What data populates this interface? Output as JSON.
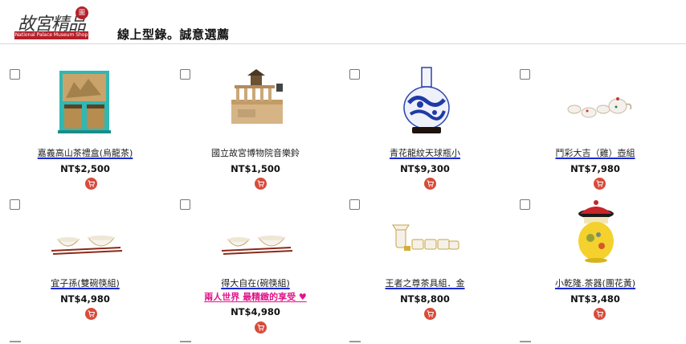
{
  "header": {
    "logo_text": "故宮精品",
    "logo_seal": "圖",
    "logo_band": "National Palace Museum Shop",
    "title": "線上型錄。誠意選薦"
  },
  "products": [
    {
      "name": "嘉義高山茶禮盒(烏龍茶)",
      "price": "NT$2,500",
      "linked": true,
      "promo": "",
      "image": "tea-gift-box"
    },
    {
      "name": "國立故宮博物院音樂鈴",
      "price": "NT$1,500",
      "linked": false,
      "promo": "",
      "image": "music-box"
    },
    {
      "name": "青花龍紋天球瓶小",
      "price": "NT$9,300",
      "linked": true,
      "promo": "",
      "image": "blue-white-vase"
    },
    {
      "name": "鬥彩大吉（雞）壺組",
      "price": "NT$7,980",
      "linked": true,
      "promo": "",
      "image": "teapot-set"
    },
    {
      "name": "宜子孫(雙碗筷組)",
      "price": "NT$4,980",
      "linked": true,
      "promo": "",
      "image": "bowl-chopstick-set"
    },
    {
      "name": "得大自在(碗筷組)",
      "price": "NT$4,980",
      "linked": true,
      "promo": "兩人世界 最精緻的享受 ♥",
      "image": "bowl-chopstick-set-2"
    },
    {
      "name": "王者之尊茶具組．金",
      "price": "NT$8,800",
      "linked": true,
      "promo": "",
      "image": "gold-tea-set"
    },
    {
      "name": "小乾隆.茶器(團花黃)",
      "price": "NT$3,480",
      "linked": true,
      "promo": "",
      "image": "qianlong-tea-jar"
    }
  ]
}
